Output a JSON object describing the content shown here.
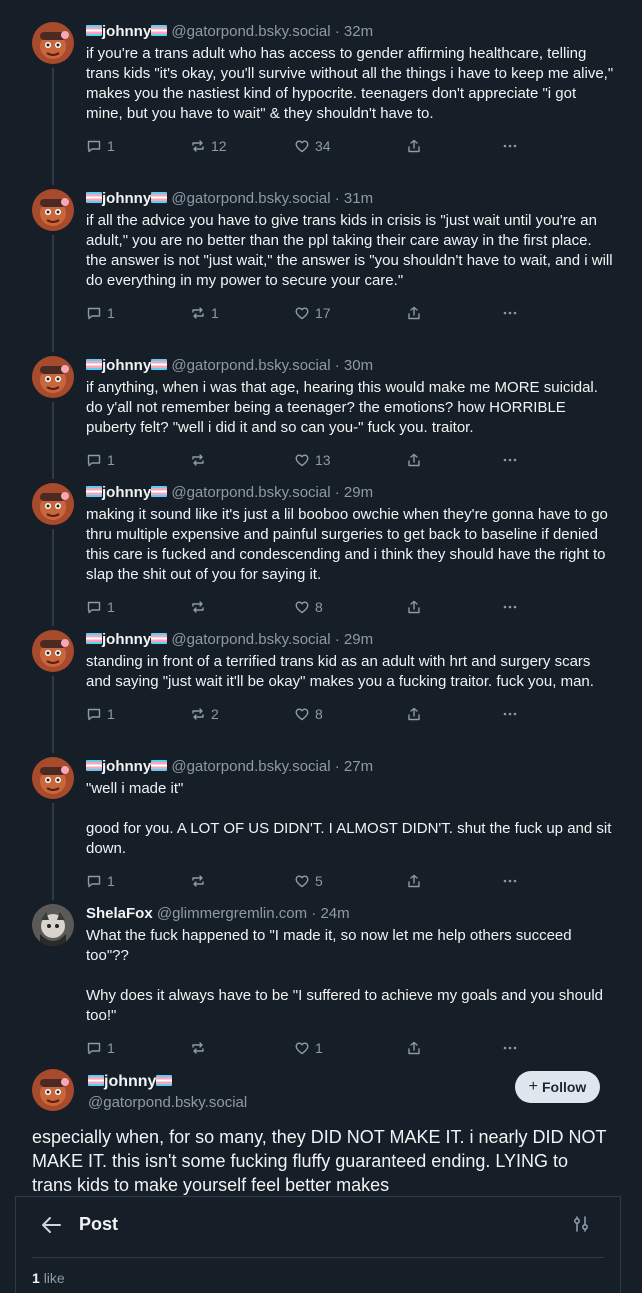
{
  "thread": [
    {
      "author": "johnny",
      "handle": "@gatorpond.bsky.social",
      "time": "32m",
      "text": "if you're a trans adult who has access to gender affirming healthcare, telling trans kids \"it's okay, you'll survive without all the things i have to keep me alive,\" makes you the nastiest kind of hypocrite. teenagers don't appreciate \"i got mine, but you have to wait\" & they shouldn't have to.",
      "replies": "1",
      "reposts": "12",
      "likes": "34"
    },
    {
      "author": "johnny",
      "handle": "@gatorpond.bsky.social",
      "time": "31m",
      "text": "if all the advice you have to give trans kids in crisis is \"just wait until you're an adult,\" you are no better than the ppl taking their care away in the first place. the answer is not \"just wait,\" the answer is \"you shouldn't have to wait, and i will do everything in my power to secure your care.\"",
      "replies": "1",
      "reposts": "1",
      "likes": "17"
    },
    {
      "author": "johnny",
      "handle": "@gatorpond.bsky.social",
      "time": "30m",
      "text": "if anything, when i was that age, hearing this would make me MORE suicidal. do y'all not remember being a teenager? the emotions? how HORRIBLE puberty felt? \"well i did it and so can you-\" fuck you. traitor.",
      "replies": "1",
      "reposts": "",
      "likes": "13"
    },
    {
      "author": "johnny",
      "handle": "@gatorpond.bsky.social",
      "time": "29m",
      "text": "making it sound like it's just a lil booboo owchie when they're gonna have to go thru multiple expensive and painful surgeries to get back to baseline if denied this care is fucked and condescending and i think they should have the right to slap the shit out of you for saying it.",
      "replies": "1",
      "reposts": "",
      "likes": "8"
    },
    {
      "author": "johnny",
      "handle": "@gatorpond.bsky.social",
      "time": "29m",
      "text": "standing in front of a terrified trans kid as an adult with hrt and surgery scars and saying \"just wait it'll be okay\" makes you a fucking traitor. fuck you, man.",
      "replies": "1",
      "reposts": "2",
      "likes": "8"
    },
    {
      "author": "johnny",
      "handle": "@gatorpond.bsky.social",
      "time": "27m",
      "text": "\"well i made it\"\n\ngood for you. A LOT OF US DIDN'T. I ALMOST DIDN'T. shut the fuck up and sit down.",
      "replies": "1",
      "reposts": "",
      "likes": "5"
    },
    {
      "author": "ShelaFox",
      "handle": "@glimmergremlin.com",
      "time": "24m",
      "text": "What the fuck happened to \"I made it, so now let me help others succeed too\"??\n\nWhy does it always have to be \"I suffered to achieve my goals and you should too!\"",
      "replies": "1",
      "reposts": "",
      "likes": "1"
    }
  ],
  "main_post": {
    "author": "johnny",
    "handle": "@gatorpond.bsky.social",
    "follow_label": "Follow",
    "text": "especially when, for so many, they DID NOT MAKE IT. i nearly DID NOT MAKE IT. this isn't some fucking fluffy guaranteed ending. LYING to trans kids to make yourself feel better makes"
  },
  "panel": {
    "title": "Post",
    "likes_count": "1",
    "likes_label": "like"
  },
  "colors": {
    "background": "#161e27",
    "muted": "#8d9aa8",
    "border": "#2e3a46",
    "flag_blue": "#5bcefa",
    "flag_pink": "#f5a9b8"
  }
}
